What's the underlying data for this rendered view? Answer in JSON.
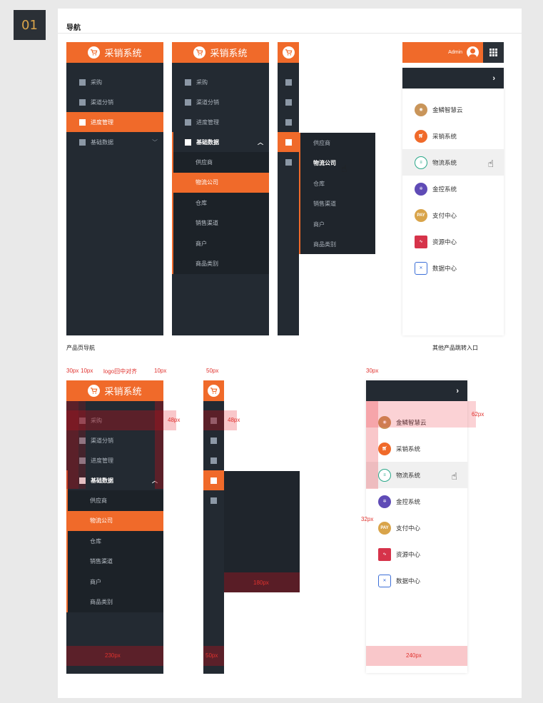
{
  "section_number": "01",
  "card_title": "导航",
  "brand_name": "采销系统",
  "nav_items": [
    "采购",
    "渠道分销",
    "进度管理",
    "基础数据"
  ],
  "sub_items": [
    "供应商",
    "物流公司",
    "仓库",
    "销售渠道",
    "商户",
    "商品类别"
  ],
  "admin_label": "Admin",
  "products": [
    {
      "name": "金鳞智慧云",
      "icon": "golden-scale-cloud-icon",
      "color": "#c9955a"
    },
    {
      "name": "采销系统",
      "icon": "cart-icon",
      "color": "#f06a2a"
    },
    {
      "name": "物流系统",
      "icon": "truck-icon",
      "color": "#2aa889"
    },
    {
      "name": "金控系统",
      "icon": "gear-icon",
      "color": "#5f4bb6"
    },
    {
      "name": "支付中心",
      "icon": "pay-icon",
      "icon_text": "PAY",
      "color": "#d9a44a"
    },
    {
      "name": "资源中心",
      "icon": "pulse-icon",
      "color": "#d6334a"
    },
    {
      "name": "数据中心",
      "icon": "cube-icon",
      "color": "#3c6fd8"
    }
  ],
  "captions": {
    "product_nav": "产品页导航",
    "other_entry": "其他产品跳转入口"
  },
  "annotations": {
    "a30": "30px",
    "a10a": "10px",
    "logo_center": "logo回中对齐",
    "a10b": "10px",
    "a50": "50px",
    "a48a": "48px",
    "a48b": "48px",
    "a180": "180px",
    "a230": "230px",
    "a50b": "50px",
    "a30b": "30px",
    "a62": "62px",
    "a32": "32px",
    "a240": "240px"
  },
  "colors": {
    "accent": "#f06a2a",
    "sidebar_bg": "#232a32",
    "annotation": "#e0322e"
  }
}
